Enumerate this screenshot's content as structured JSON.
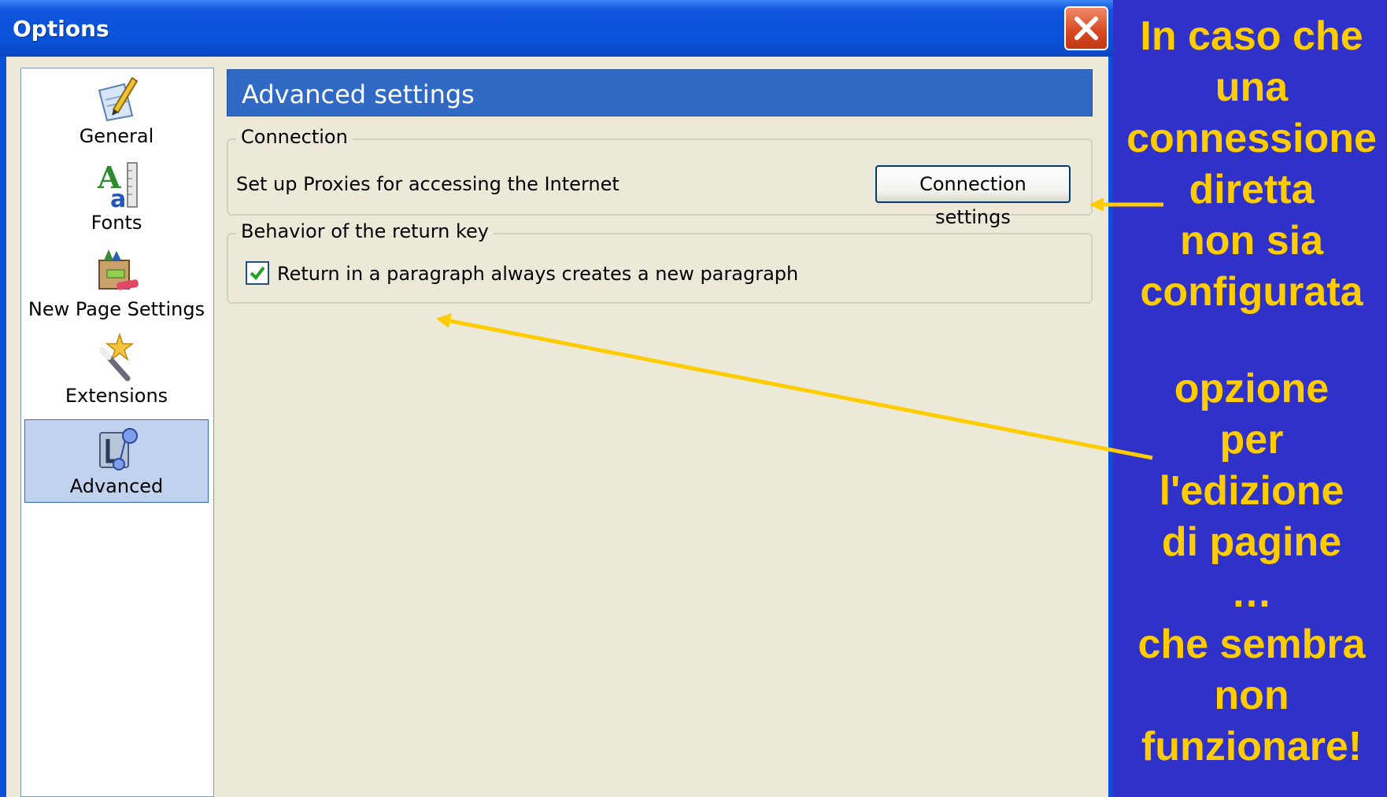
{
  "window": {
    "title": "Options",
    "close_icon": "close-icon"
  },
  "sidebar": {
    "items": [
      {
        "label": "General",
        "icon": "pencil-paper-icon",
        "selected": false
      },
      {
        "label": "Fonts",
        "icon": "fonts-icon",
        "selected": false
      },
      {
        "label": "New Page Settings",
        "icon": "new-page-icon",
        "selected": false
      },
      {
        "label": "Extensions",
        "icon": "magic-wand-icon",
        "selected": false
      },
      {
        "label": "Advanced",
        "icon": "advanced-gear-icon",
        "selected": true
      }
    ]
  },
  "panel": {
    "title": "Advanced settings",
    "connection": {
      "caption": "Connection",
      "description": "Set up Proxies for accessing the Internet",
      "button_label": "Connection settings"
    },
    "return_key": {
      "caption": "Behavior of the return key",
      "checkbox_label": "Return in a paragraph always creates a new paragraph",
      "checked": true
    }
  },
  "annotations": {
    "top_lines": [
      "In caso che",
      "una",
      "connessione",
      "diretta",
      "non sia",
      "configurata"
    ],
    "bottom_lines": [
      "opzione",
      "per",
      "l'edizione",
      "di pagine",
      "…",
      "che sembra",
      "non",
      "funzionare!"
    ],
    "color": "#ffcc00"
  },
  "colors": {
    "background": "#2f31c8",
    "titlebar": "#0852d9",
    "dialog": "#ece9d8",
    "selection": "#c1d2ee",
    "panel_title": "#316ac5"
  }
}
